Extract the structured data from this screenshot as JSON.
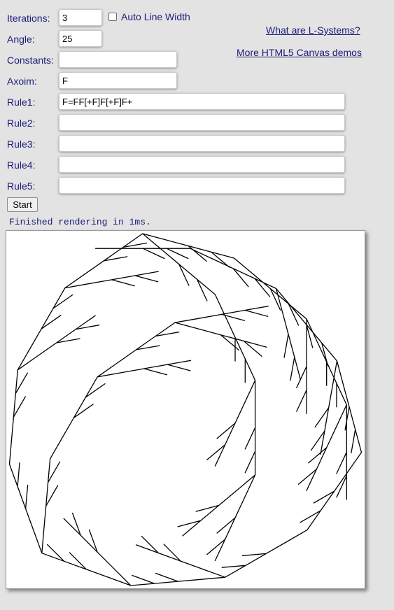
{
  "form": {
    "iterations": {
      "label": "Iterations:",
      "value": "3"
    },
    "auto_line_width": {
      "label": "Auto Line Width",
      "checked": false
    },
    "angle": {
      "label": "Angle:",
      "value": "25"
    },
    "constants": {
      "label": "Constants:",
      "value": ""
    },
    "axiom": {
      "label": "Axoim:",
      "value": "F"
    },
    "rules": [
      {
        "label": "Rule1:",
        "value": "F=FF[+F]F[+F]F+"
      },
      {
        "label": "Rule2:",
        "value": ""
      },
      {
        "label": "Rule3:",
        "value": ""
      },
      {
        "label": "Rule4:",
        "value": ""
      },
      {
        "label": "Rule5:",
        "value": ""
      }
    ],
    "start_label": "Start"
  },
  "links": {
    "what_are": "What are L-Systems?",
    "more_demos": "More HTML5 Canvas demos"
  },
  "status": "Finished rendering in 1ms.",
  "canvas": {
    "stroke": "#000000",
    "background": "#ffffff"
  }
}
